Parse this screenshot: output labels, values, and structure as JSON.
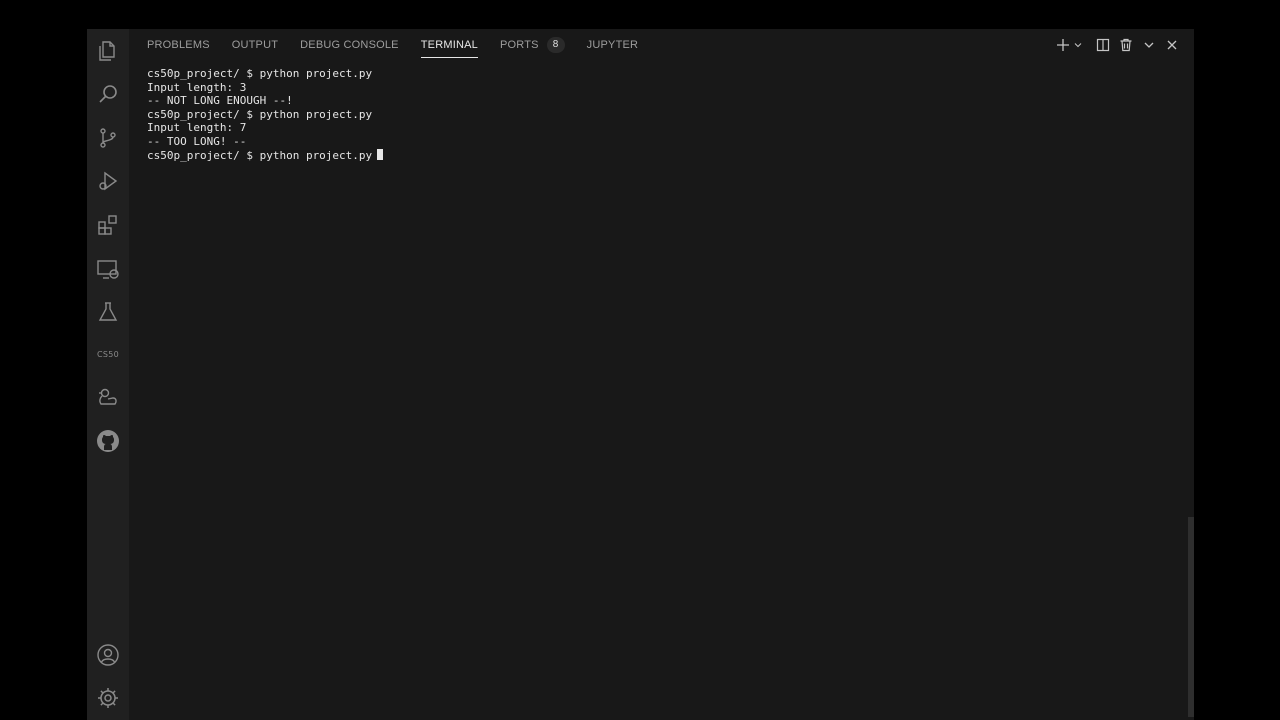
{
  "tabs": [
    {
      "label": "PROBLEMS"
    },
    {
      "label": "OUTPUT"
    },
    {
      "label": "DEBUG CONSOLE"
    },
    {
      "label": "TERMINAL"
    },
    {
      "label": "PORTS",
      "badge": "8"
    },
    {
      "label": "JUPYTER"
    }
  ],
  "active_tab": "TERMINAL",
  "activity_bar": {
    "items": [
      {
        "icon": "explorer-icon"
      },
      {
        "icon": "search-icon"
      },
      {
        "icon": "source-control-icon"
      },
      {
        "icon": "run-debug-icon"
      },
      {
        "icon": "extensions-icon"
      },
      {
        "icon": "remote-explorer-icon"
      },
      {
        "icon": "testing-icon"
      },
      {
        "icon": "cs50-icon",
        "text": "CS50"
      },
      {
        "icon": "duck-icon"
      },
      {
        "icon": "github-icon"
      }
    ],
    "bottom": [
      {
        "icon": "account-icon"
      },
      {
        "icon": "settings-gear-icon"
      }
    ]
  },
  "panel_actions": [
    {
      "icon": "new-terminal-plus-icon"
    },
    {
      "icon": "terminal-dropdown-chevron-icon"
    },
    {
      "icon": "split-terminal-icon"
    },
    {
      "icon": "trash-icon"
    },
    {
      "icon": "more-chevron-down-icon"
    },
    {
      "icon": "close-icon"
    }
  ],
  "terminal": {
    "lines": [
      "cs50p_project/ $ python project.py",
      "Input length: 3",
      "-- NOT LONG ENOUGH --!",
      "cs50p_project/ $ python project.py",
      "Input length: 7",
      "-- TOO LONG! --",
      "cs50p_project/ $ python project.py"
    ]
  },
  "colors": {
    "background": "#181818",
    "activity_bar": "#202020",
    "text": "#e6e6e6",
    "tab_inactive": "#9d9d9d",
    "icon": "#8a8a8a"
  }
}
